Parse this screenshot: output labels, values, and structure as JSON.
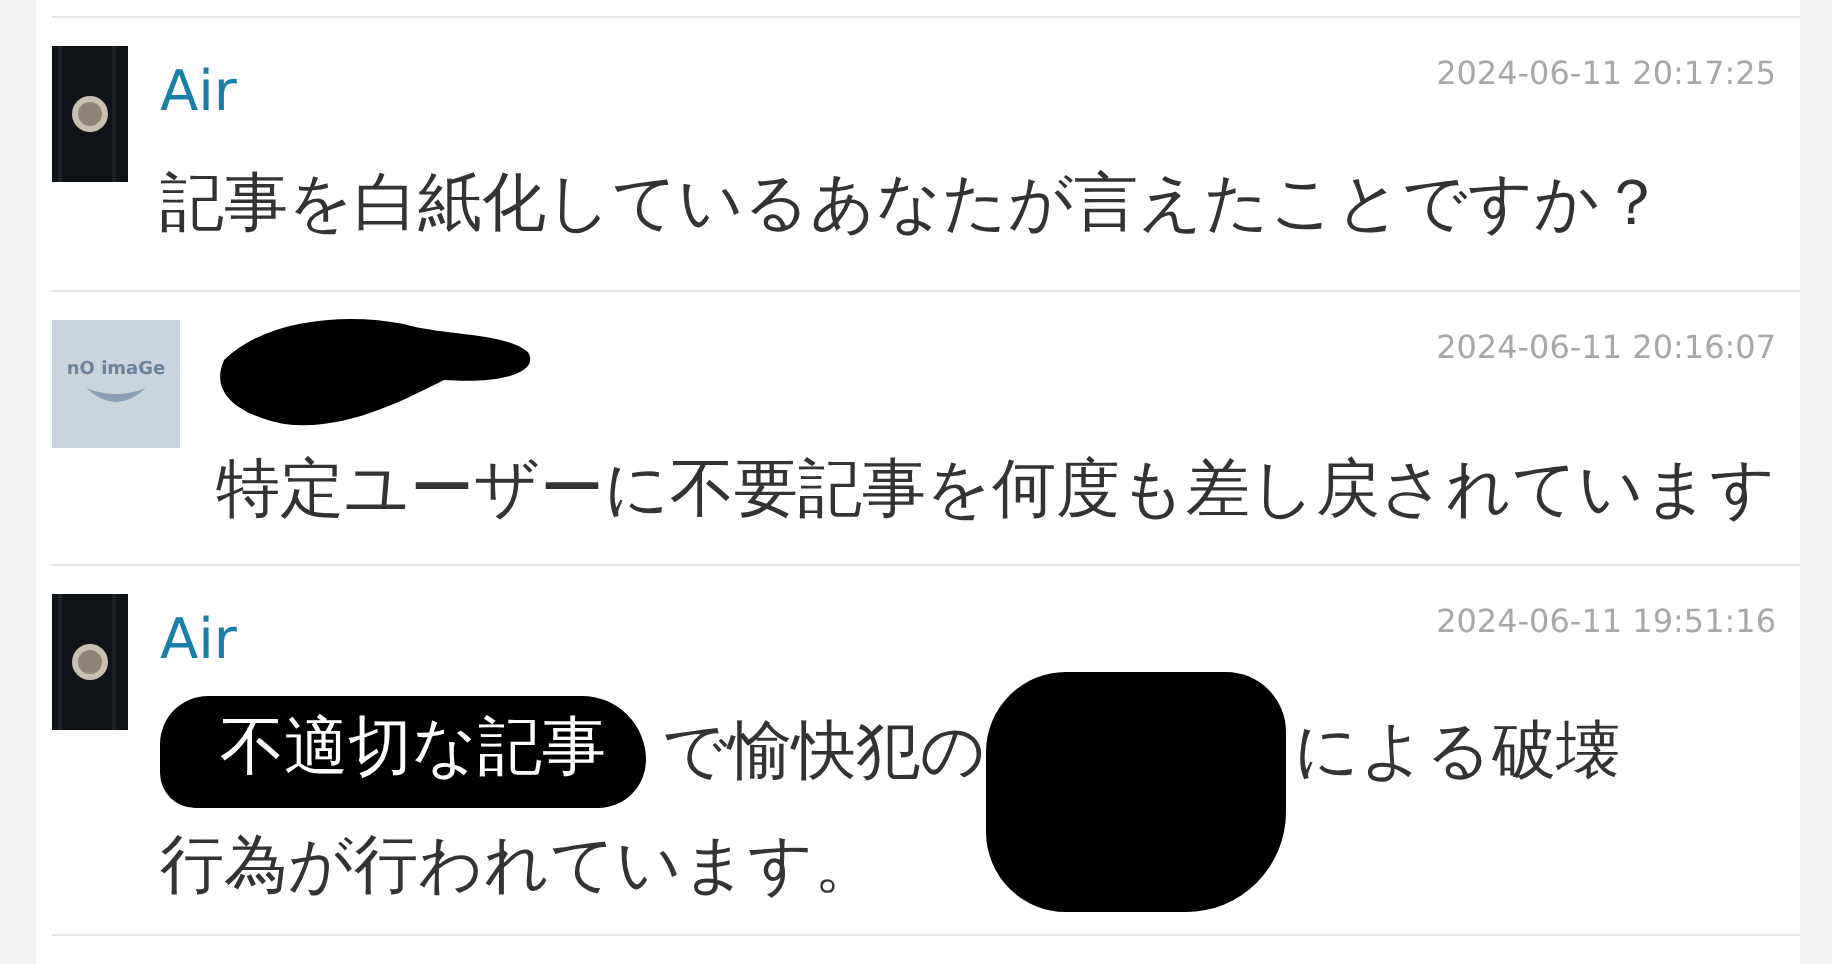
{
  "comments": [
    {
      "author": {
        "name": "Air",
        "redacted": false
      },
      "avatar": {
        "kind": "photo"
      },
      "time": "2024-06-11 20:17:25",
      "lines": [
        [
          {
            "kind": "text",
            "text": "記事を白紙化しているあなたが言えたことですか？"
          }
        ]
      ]
    },
    {
      "author": {
        "redacted": true
      },
      "avatar": {
        "kind": "noimage",
        "label": "nO imaGe"
      },
      "time": "2024-06-11 20:16:07",
      "lines": [
        [
          {
            "kind": "text",
            "text": "特定ユーザーに不要記事を何度も差し戻されています"
          }
        ]
      ]
    },
    {
      "author": {
        "name": "Air",
        "redacted": false
      },
      "avatar": {
        "kind": "photo"
      },
      "time": "2024-06-11 19:51:16",
      "lines": [
        [
          {
            "kind": "label",
            "text": "不適切な記事"
          },
          {
            "kind": "text",
            "text": "で愉快犯の"
          },
          {
            "kind": "blot"
          },
          {
            "kind": "text",
            "text": "による破壊"
          }
        ],
        [
          {
            "kind": "text",
            "text": "行為が行われています。"
          }
        ]
      ]
    }
  ]
}
